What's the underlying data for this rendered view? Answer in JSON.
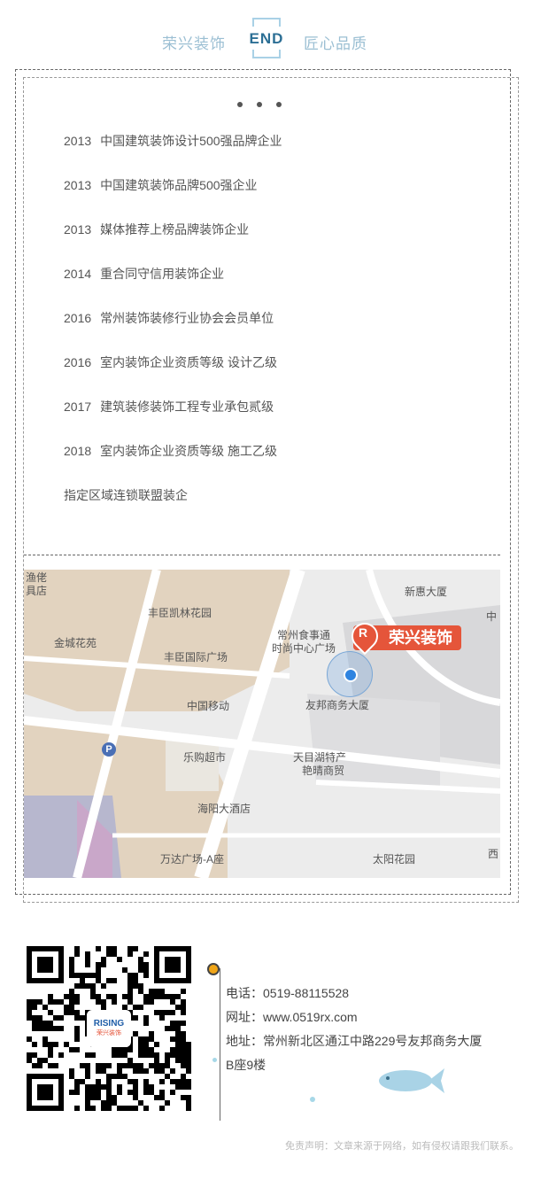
{
  "header": {
    "left": "荣兴装饰",
    "end": "END",
    "right": "匠心品质"
  },
  "list": [
    {
      "year": "2013",
      "text": "中国建筑装饰设计500强品牌企业"
    },
    {
      "year": "2013",
      "text": "中国建筑装饰品牌500强企业"
    },
    {
      "year": "2013",
      "text": "媒体推荐上榜品牌装饰企业"
    },
    {
      "year": "2014",
      "text": "重合同守信用装饰企业"
    },
    {
      "year": "2016",
      "text": "常州装饰装修行业协会会员单位"
    },
    {
      "year": "2016",
      "text": "室内装饰企业资质等级 设计乙级"
    },
    {
      "year": "2017",
      "text": "建筑装修装饰工程专业承包贰级"
    },
    {
      "year": "2018",
      "text": "室内装饰企业资质等级 施工乙级"
    },
    {
      "year": "",
      "text": "指定区域连锁联盟装企"
    }
  ],
  "map": {
    "brand": "荣兴装饰",
    "pin_letter": "R",
    "labels": {
      "yu": "渔佬",
      "jujudian": "具店",
      "xinhui": "新惠大厦",
      "zhong": "中",
      "fengchen_kailin": "丰臣凯林花园",
      "changzhou_food": "常州食事通",
      "shishang": "时尚中心广场",
      "jincheng": "金城花苑",
      "fengchen_guoji": "丰臣国际广场",
      "zhongguo_yidong": "中国移动",
      "youbang": "友邦商务大厦",
      "legou": "乐购超市",
      "tianmuhu": "天目湖特产",
      "yanyang": "艳晴商贸",
      "haiyang": "海阳大酒店",
      "wanda": "万达广场-A座",
      "taiyang": "太阳花园",
      "xi": "西",
      "p": "P"
    }
  },
  "qr": {
    "logo_title": "RISING",
    "logo_sub": "荣兴装饰"
  },
  "contact": {
    "phone": "电话：0519-88115528",
    "website": "网址：www.0519rx.com",
    "address_1": "地址：常州新北区通江中路229号友邦商务大厦",
    "address_2": "B座9楼"
  },
  "disclaimer": "免责声明：文章来源于网络，如有侵权请跟我们联系。",
  "colors": {
    "accent": "#2c6f95",
    "header_light": "#9bbfd3",
    "brand_red": "#e5553a"
  }
}
